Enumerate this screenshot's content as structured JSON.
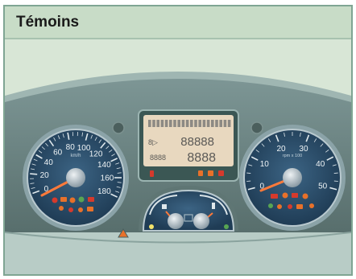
{
  "header": {
    "title": "Témoins"
  },
  "speedometer": {
    "ticks": [
      "0",
      "20",
      "40",
      "60",
      "80",
      "100",
      "120",
      "140",
      "160",
      "180"
    ],
    "unit": "km/h"
  },
  "tachometer": {
    "ticks": [
      "0",
      "10",
      "20",
      "30",
      "40",
      "50"
    ],
    "unit": "rpm x 100"
  },
  "display": {
    "clock": "88888",
    "odometer": "8888",
    "trip": "8888"
  },
  "colors": {
    "dashboard": "#5f7674",
    "dial": "#2c4f6a",
    "lcd": "#e8d8bf",
    "warning_orange": "#e8712a",
    "warning_red": "#d63a2c",
    "warning_green": "#58a552"
  }
}
